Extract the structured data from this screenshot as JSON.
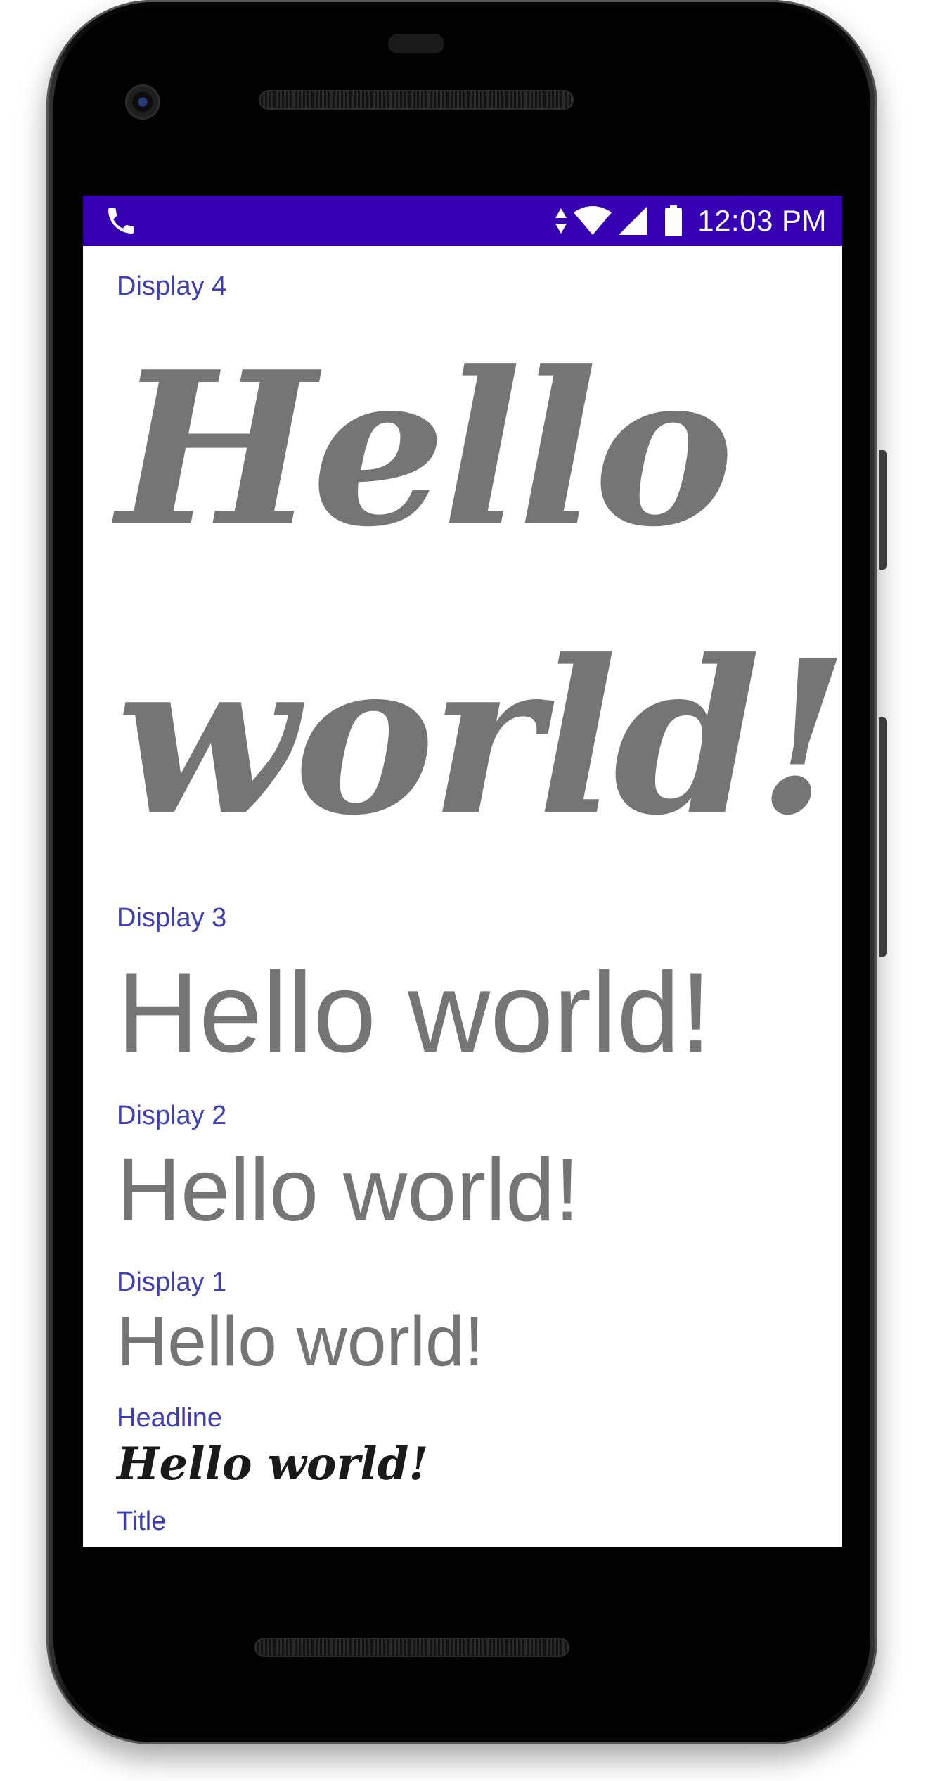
{
  "status_bar": {
    "background": "#3700b3",
    "left_icon": "phone-icon",
    "time": "12:03 PM",
    "icons": [
      "data-arrows-icon",
      "wifi-icon",
      "cell-signal-icon",
      "battery-icon"
    ]
  },
  "typography": {
    "accent_label_color": "#3f3fb5",
    "sample_color": "#757575",
    "items": [
      {
        "label": "Display 4",
        "sample": "Hello world!"
      },
      {
        "label": "Display 3",
        "sample": "Hello world!"
      },
      {
        "label": "Display 2",
        "sample": "Hello world!"
      },
      {
        "label": "Display 1",
        "sample": "Hello world!"
      },
      {
        "label": "Headline",
        "sample": "Hello world!"
      },
      {
        "label": "Title"
      }
    ]
  }
}
